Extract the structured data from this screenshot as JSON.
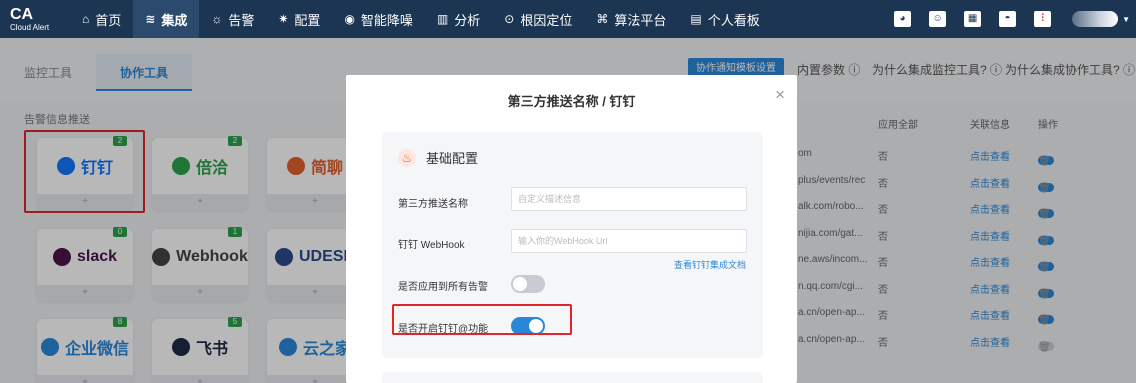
{
  "brand": {
    "name": "CA",
    "sub": "Cloud Alert"
  },
  "nav": {
    "items": [
      {
        "icon": "home-icon",
        "glyph": "⌂",
        "label": "首页",
        "active": false
      },
      {
        "icon": "layers-icon",
        "glyph": "≋",
        "label": "集成",
        "active": true
      },
      {
        "icon": "alarm-icon",
        "glyph": "☼",
        "label": "告警",
        "active": false
      },
      {
        "icon": "gear-icon",
        "glyph": "✷",
        "label": "配置",
        "active": false
      },
      {
        "icon": "noise-icon",
        "glyph": "◉",
        "label": "智能降噪",
        "active": false
      },
      {
        "icon": "chart-icon",
        "glyph": "▥",
        "label": "分析",
        "active": false
      },
      {
        "icon": "target-icon",
        "glyph": "⊙",
        "label": "根因定位",
        "active": false
      },
      {
        "icon": "algorithm-icon",
        "glyph": "⌘",
        "label": "算法平台",
        "active": false
      },
      {
        "icon": "dashboard-icon",
        "glyph": "▤",
        "label": "个人看板",
        "active": false
      }
    ],
    "right_icons": [
      {
        "name": "help-icon",
        "glyph": "◕"
      },
      {
        "name": "robot-icon",
        "glyph": "☺"
      },
      {
        "name": "calendar-icon",
        "glyph": "▦"
      },
      {
        "name": "bell-icon",
        "glyph": "◓"
      },
      {
        "name": "equalizer-icon",
        "glyph": "⫶"
      }
    ]
  },
  "tabs": [
    "监控工具",
    "协作工具"
  ],
  "header_buttons": {
    "template": "协作通知模板设置",
    "builtin_params": "内置参数 ⓘ",
    "why_monitor": "为什么集成监控工具? ⓘ",
    "why_collab": "为什么集成协作工具? ⓘ"
  },
  "section_title": "告警信息推送",
  "cards": [
    {
      "label": "钉钉",
      "badge": "2",
      "color": "#1677ff"
    },
    {
      "label": "倍洽",
      "badge": "2",
      "color": "#2ba34a"
    },
    {
      "label": "简聊",
      "badge": "",
      "color": "#e4602f"
    },
    {
      "label": "slack",
      "badge": "0",
      "color": "#4a154b"
    },
    {
      "label": "Webhook",
      "badge": "1",
      "color": "#444444"
    },
    {
      "label": "UDESK",
      "badge": "",
      "color": "#2b4a8e"
    },
    {
      "label": "企业微信",
      "badge": "8",
      "color": "#2a87d8"
    },
    {
      "label": "飞书",
      "badge": "5",
      "color": "#1f2a44"
    },
    {
      "label": "云之家",
      "badge": "",
      "color": "#2a87d8"
    }
  ],
  "card_plus": "+",
  "table": {
    "headers": [
      "应用全部",
      "关联信息",
      "操作"
    ],
    "rows": [
      {
        "url": "om",
        "apply": "否",
        "link": "点击查看",
        "enabled": true
      },
      {
        "url": "plus/events/rec",
        "apply": "否",
        "link": "点击查看",
        "enabled": true
      },
      {
        "url": "alk.com/robo...",
        "apply": "否",
        "link": "点击查看",
        "enabled": true
      },
      {
        "url": "nijia.com/gat...",
        "apply": "否",
        "link": "点击查看",
        "enabled": true
      },
      {
        "url": "ne.aws/incom...",
        "apply": "否",
        "link": "点击查看",
        "enabled": true
      },
      {
        "url": "n.qq.com/cgi...",
        "apply": "否",
        "link": "点击查看",
        "enabled": true
      },
      {
        "url": "a.cn/open-ap...",
        "apply": "否",
        "link": "点击查看",
        "enabled": true
      },
      {
        "url": "a.cn/open-ap...",
        "apply": "否",
        "link": "点击查看",
        "enabled": false
      }
    ]
  },
  "modal": {
    "title": "第三方推送名称 / 钉钉",
    "close": "×",
    "section": "基础配置",
    "section_icon": "♨",
    "fields": {
      "name_label": "第三方推送名称",
      "name_placeholder": "自定义描述信息",
      "webhook_label": "钉钉 WebHook",
      "webhook_placeholder": "输入你的WebHook Url",
      "doc_link": "查看钉钉集成文档",
      "apply_all_label": "是否应用到所有告警",
      "apply_all_on": false,
      "at_label": "是否开启钉钉@功能",
      "at_on": true
    }
  },
  "colors": {
    "nav_bg": "#1c3553",
    "accent": "#2a87d8",
    "highlight": "#e0252b"
  }
}
